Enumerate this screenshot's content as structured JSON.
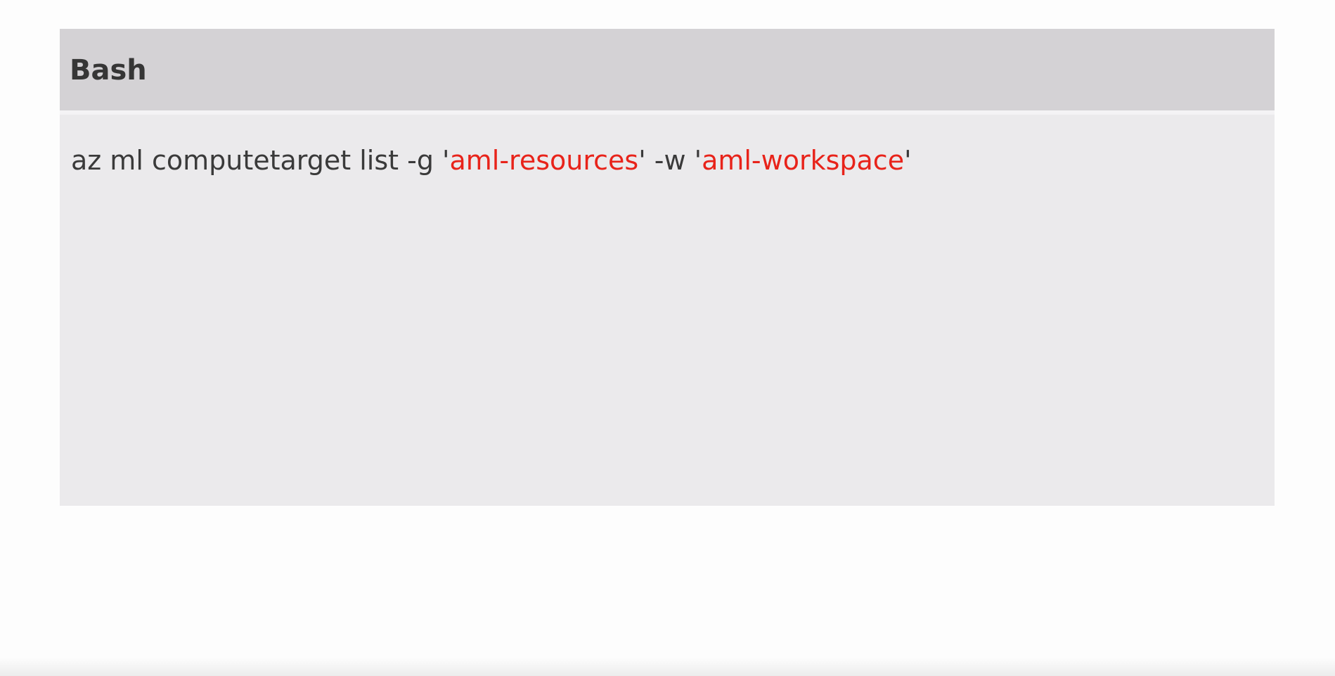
{
  "code_block": {
    "language": "Bash",
    "line": {
      "t1": "az ml computetarget list -g '",
      "arg1": "aml-resources",
      "t2": "' -w '",
      "arg2": "aml-workspace",
      "t3": "'"
    }
  },
  "colors": {
    "header_bg": "#d4d2d5",
    "body_bg": "#ebeaec",
    "text": "#3a3a3a",
    "string_highlight": "#e8231a"
  }
}
